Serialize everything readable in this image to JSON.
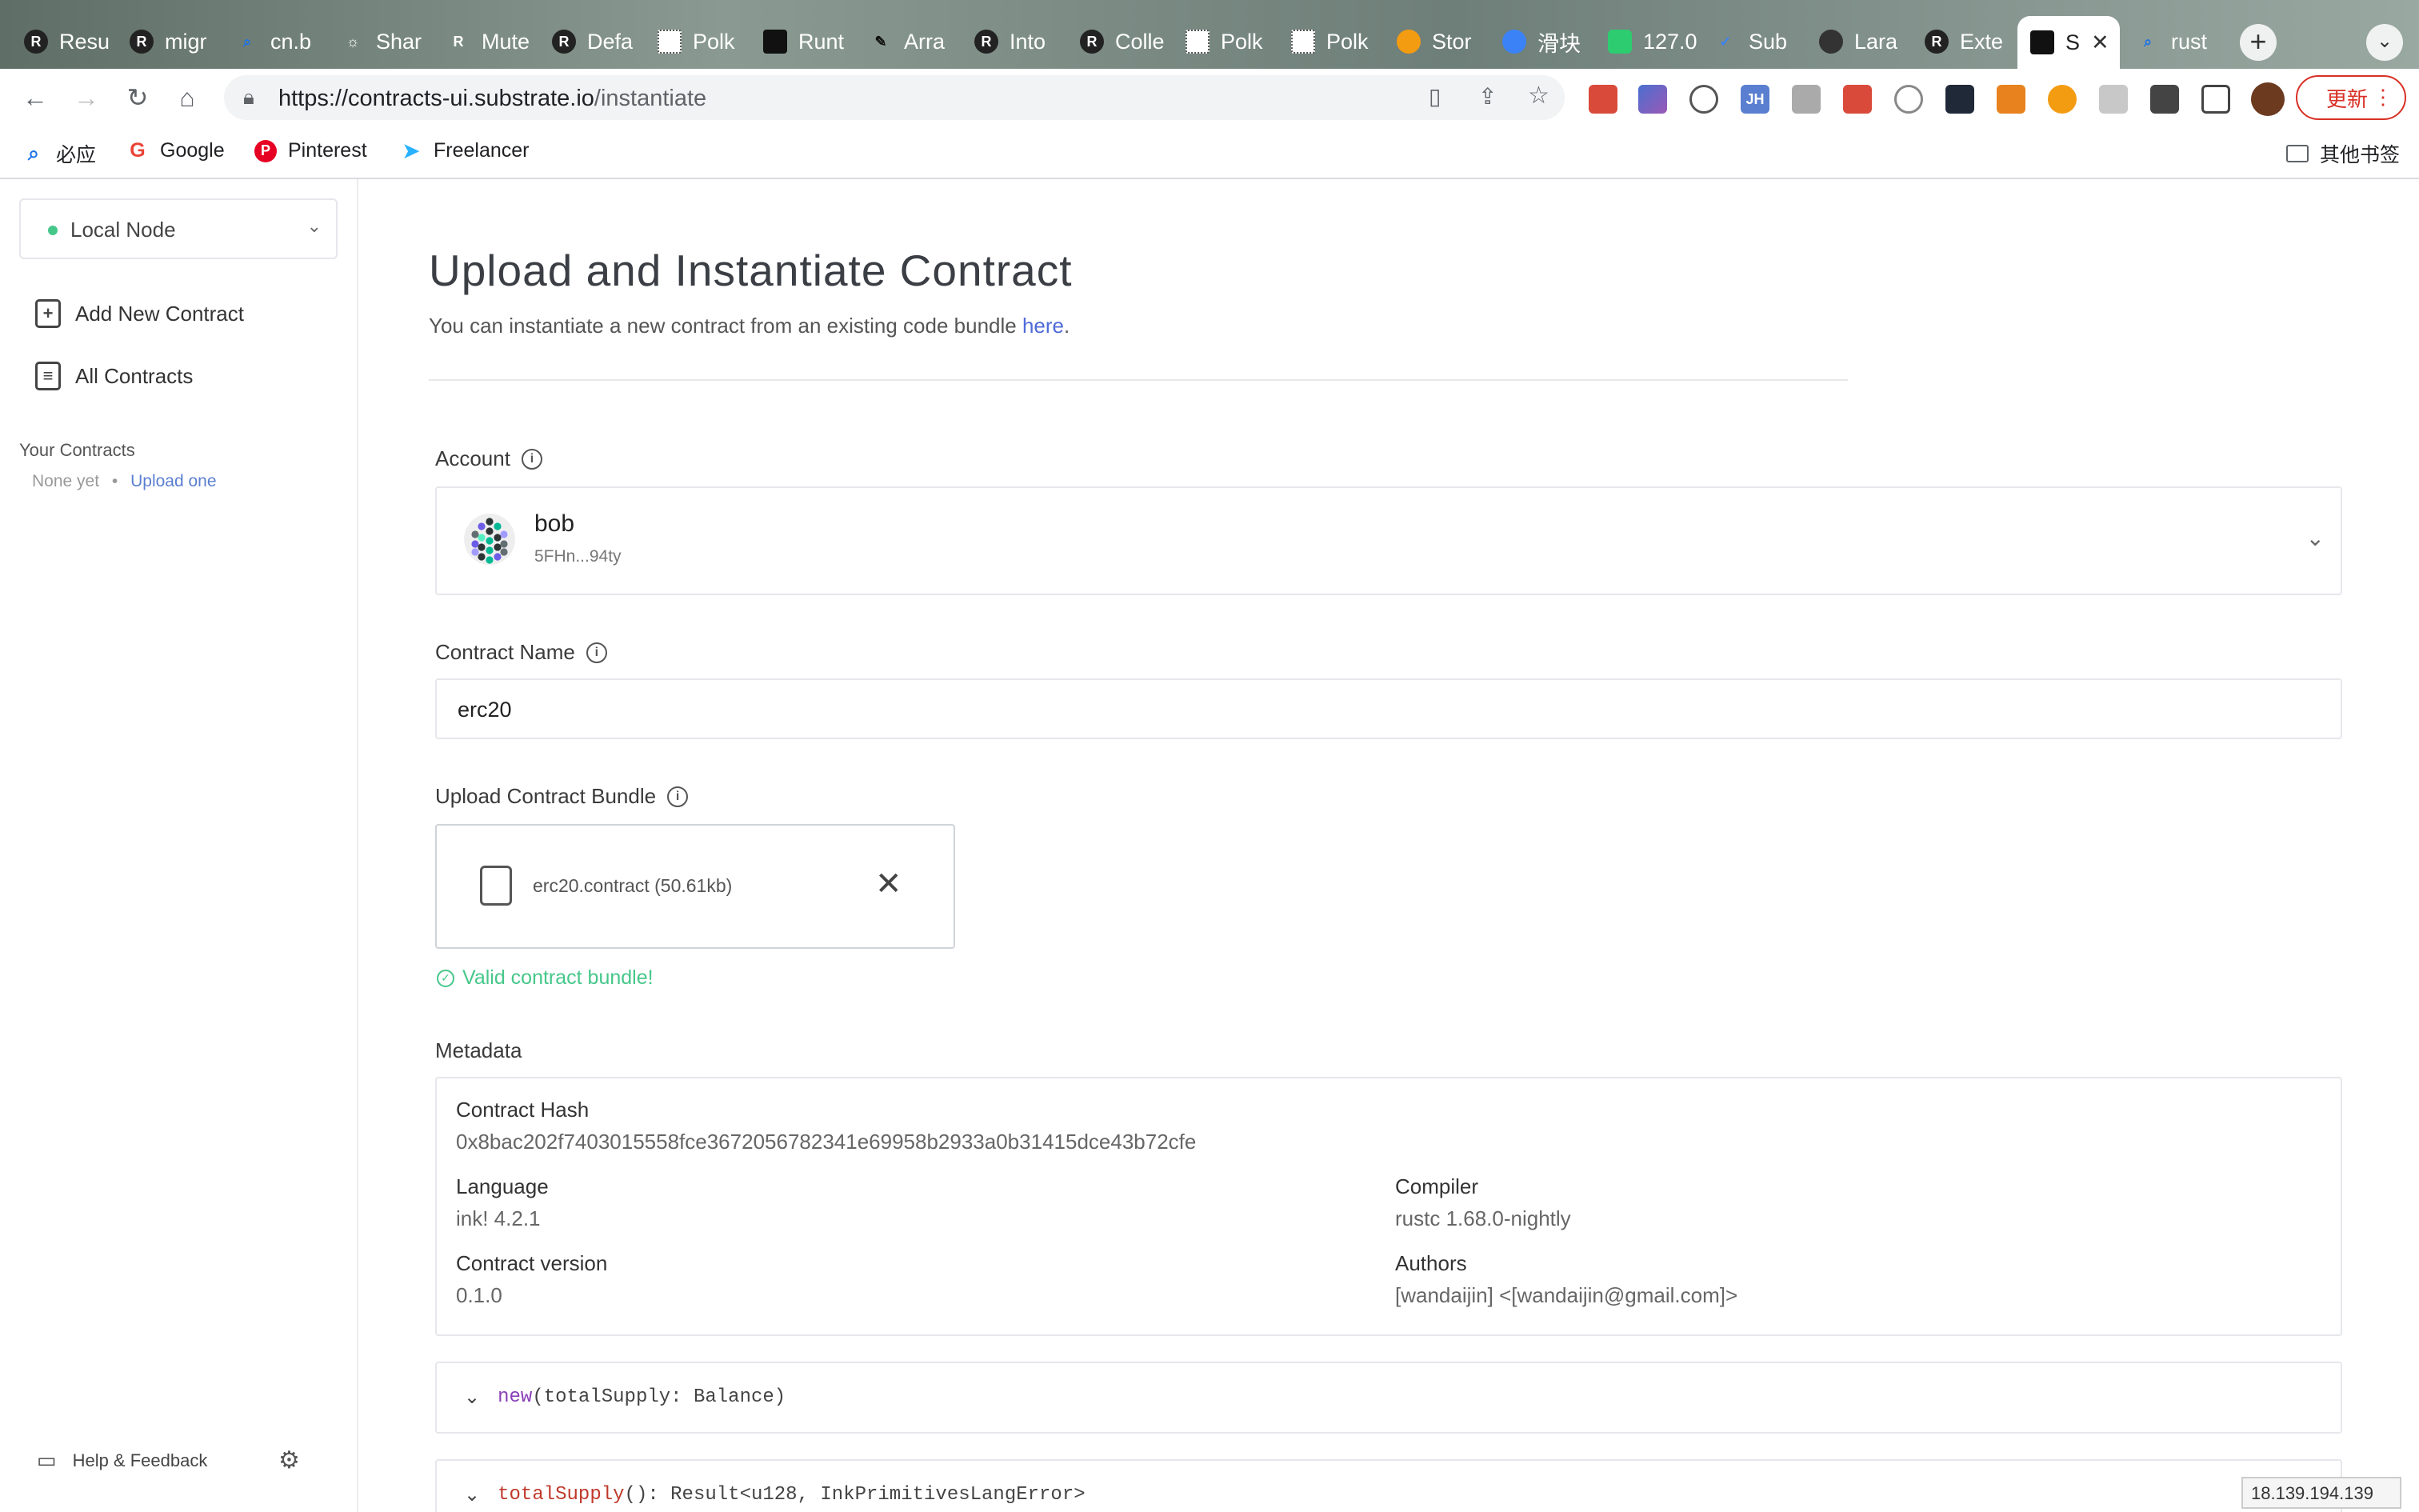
{
  "browser": {
    "tabs": [
      {
        "label": "Resu",
        "icon": "rust-icon"
      },
      {
        "label": "migr",
        "icon": "rust-icon"
      },
      {
        "label": "cn.b",
        "icon": "search-icon"
      },
      {
        "label": "Shar",
        "icon": "sun-icon"
      },
      {
        "label": "Mute",
        "icon": "rust-book-icon"
      },
      {
        "label": "Defa",
        "icon": "rust-icon"
      },
      {
        "label": "Polk",
        "icon": "polkadot-icon"
      },
      {
        "label": "Runt",
        "icon": "terminal-icon"
      },
      {
        "label": "Arra",
        "icon": "feather-icon"
      },
      {
        "label": "Into",
        "icon": "rust-icon"
      },
      {
        "label": "Colle",
        "icon": "rust-icon"
      },
      {
        "label": "Polk",
        "icon": "polkadot-icon"
      },
      {
        "label": "Polk",
        "icon": "polkadot-icon"
      },
      {
        "label": "Stor",
        "icon": "substrate-icon"
      },
      {
        "label": "滑块",
        "icon": "bolt-icon"
      },
      {
        "label": "127.0",
        "icon": "bolt-green-icon"
      },
      {
        "label": "Sub",
        "icon": "check-icon"
      },
      {
        "label": "Lara",
        "icon": "globe-icon"
      },
      {
        "label": "Exte",
        "icon": "github-icon"
      },
      {
        "label": "S",
        "icon": "terminal-icon"
      },
      {
        "label": "rust",
        "icon": "search-icon"
      }
    ],
    "url_host": "https://contracts-ui.substrate.io",
    "url_path": "/instantiate",
    "update_label": "更新",
    "bookmarks": [
      {
        "label": "必应",
        "icon": "search-icon"
      },
      {
        "label": "Google",
        "icon": "google-icon"
      },
      {
        "label": "Pinterest",
        "icon": "pinterest-icon"
      },
      {
        "label": "Freelancer",
        "icon": "freelancer-icon"
      }
    ],
    "other_bookmarks": "其他书签",
    "status_ip": "18.139.194.139",
    "accent": "#d93025"
  },
  "sidebar": {
    "node_label": "Local Node",
    "links": [
      {
        "label": "Add New Contract",
        "icon": "file-plus-icon"
      },
      {
        "label": "All Contracts",
        "icon": "archive-icon"
      }
    ],
    "your_contracts_heading": "Your Contracts",
    "none_yet": "None yet",
    "separator": "•",
    "upload_one": "Upload one",
    "help_label": "Help & Feedback",
    "node_status_color": "#46c78a"
  },
  "main": {
    "title": "Upload and Instantiate Contract",
    "subtitle_text": "You can instantiate a new contract from an existing code bundle ",
    "subtitle_link": "here",
    "subtitle_end": ".",
    "account_label": "Account",
    "account_name": "bob",
    "account_address": "5FHn...94ty",
    "contract_name_label": "Contract Name",
    "contract_name_value": "erc20",
    "upload_label": "Upload Contract Bundle",
    "file_name": "erc20.contract (50.61kb)",
    "valid_text": "Valid contract bundle!",
    "metadata_label": "Metadata",
    "metadata": {
      "hash_label": "Contract Hash",
      "hash_value": "0x8bac202f7403015558fce3672056782341e69958b2933a0b31415dce43b72cfe",
      "language_label": "Language",
      "language_value": "ink! 4.2.1",
      "compiler_label": "Compiler",
      "compiler_value": "rustc 1.68.0-nightly",
      "version_label": "Contract version",
      "version_value": "0.1.0",
      "authors_label": "Authors",
      "authors_value": "[wandaijin] <[wandaijin@gmail.com]>"
    },
    "messages": [
      {
        "name": "new",
        "sig": "(totalSupply: Balance)"
      },
      {
        "name": "totalSupply",
        "sig": "(): Result<u128, InkPrimitivesLangError>"
      }
    ],
    "success_color": "#46c78a",
    "link_color": "#4f6bd8"
  }
}
